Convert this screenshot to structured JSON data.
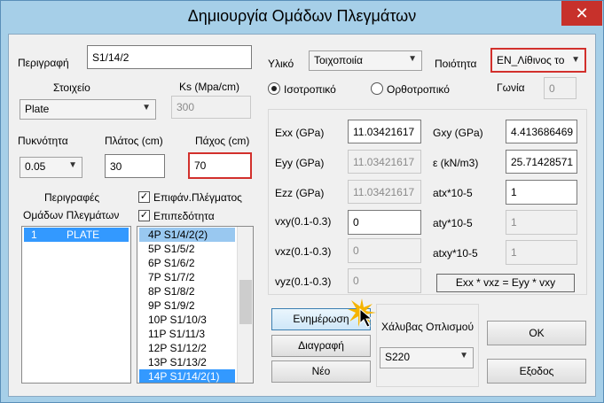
{
  "window": {
    "title": "Δημιουργία Ομάδων Πλεγμάτων",
    "close_glyph": "✕"
  },
  "left": {
    "description_label": "Περιγραφή",
    "description_value": "S1/14/2",
    "element_label": "Στοιχείο",
    "element_value": "Plate",
    "ks_label": "Ks (Mpa/cm)",
    "ks_value": "300",
    "density_label": "Πυκνότητα",
    "density_value": "0.05",
    "width_label": "Πλάτος (cm)",
    "width_value": "30",
    "thickness_label": "Πάχος (cm)",
    "thickness_value": "70",
    "descriptions_label_1": "Περιγραφές",
    "descriptions_label_2": "Ομάδων Πλεγμάτων",
    "surface_check_label": "Επιφάν.Πλέγματος",
    "level_check_label": "Επιπεδότητα",
    "check_glyph": "✓",
    "groups": [
      {
        "num": "1",
        "name": "PLATE"
      }
    ],
    "meshes": [
      "4P S1/4/2(2)",
      "5P S1/5/2",
      "6P S1/6/2",
      "7P S1/7/2",
      "8P S1/8/2",
      "9P S1/9/2",
      "10P S1/10/3",
      "11P S1/11/3",
      "12P S1/12/2",
      "13P S1/13/2",
      "14P S1/14/2(1)"
    ]
  },
  "material": {
    "material_label": "Υλικό",
    "material_value": "Τοιχοποιία",
    "quality_label": "Ποιότητα",
    "quality_value": "EN_Λίθινος το",
    "isotropic_label": "Ισοτροπικό",
    "orthotropic_label": "Ορθοτροπικό",
    "angle_label": "Γωνία",
    "angle_value": "0",
    "exx_label": "Exx (GPa)",
    "exx_value": "11.03421617",
    "eyy_label": "Eyy (GPa)",
    "eyy_value": "11.03421617",
    "ezz_label": "Ezz (GPa)",
    "ezz_value": "11.03421617",
    "vxy_label": "vxy(0.1-0.3)",
    "vxy_value": "0",
    "vxz_label": "vxz(0.1-0.3)",
    "vxz_value": "0",
    "vyz_label": "vyz(0.1-0.3)",
    "vyz_value": "0",
    "gxy_label": "Gxy (GPa)",
    "gxy_value": "4.413686469",
    "e_label": "ε (kN/m3)",
    "e_value": "25.71428571",
    "atx_label": "atx*10-5",
    "atx_value": "1",
    "aty_label": "aty*10-5",
    "aty_value": "1",
    "atxy_label": "atxy*10-5",
    "atxy_value": "1",
    "formula": "Exx * vxz = Eyy * vxy"
  },
  "buttons": {
    "update": "Ενημέρωση",
    "delete": "Διαγραφή",
    "new": "Νέο",
    "ok": "OK",
    "exit": "Εξοδος"
  },
  "steel": {
    "label": "Χάλυβας Οπλισμού",
    "value": "S220"
  },
  "dropdown_glyph": "▼"
}
